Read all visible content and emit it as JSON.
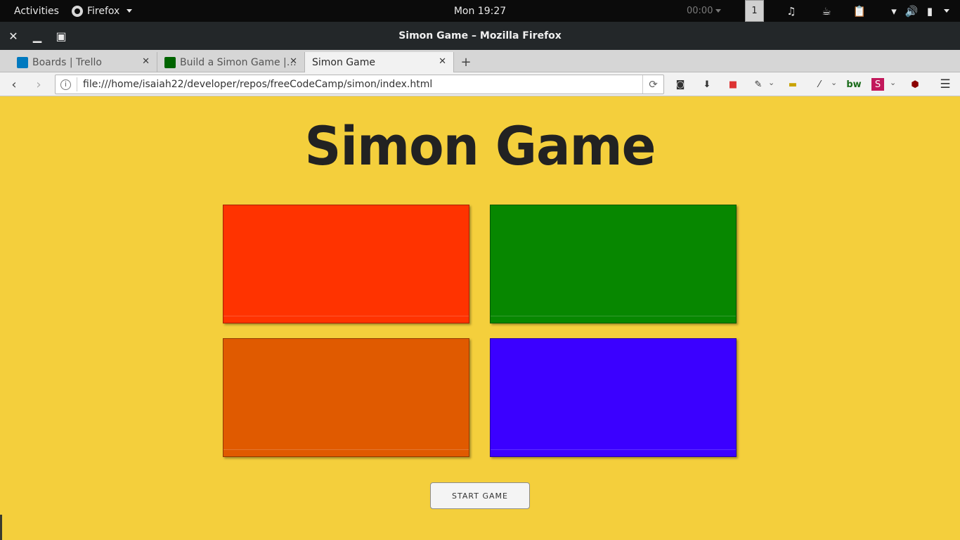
{
  "topbar": {
    "activities": "Activities",
    "app_name": "Firefox",
    "clock": "Mon 19:27",
    "timer": "00:00",
    "workspace": "1"
  },
  "window": {
    "title": "Simon Game – Mozilla Firefox"
  },
  "tabs": [
    {
      "label": "Boards | Trello",
      "favicon_color": "#0079bf",
      "active": false
    },
    {
      "label": "Build a Simon Game |…",
      "favicon_color": "#006400",
      "active": false
    },
    {
      "label": "Simon Game",
      "active": true
    }
  ],
  "navbar": {
    "url": "file:///home/isaiah22/developer/repos/freeCodeCamp/simon/index.html"
  },
  "page": {
    "title": "Simon Game",
    "pads": [
      {
        "name": "red",
        "color": "#ff3300"
      },
      {
        "name": "green",
        "color": "#078700"
      },
      {
        "name": "orange",
        "color": "#e05a00"
      },
      {
        "name": "blue",
        "color": "#3b00ff"
      }
    ],
    "start_button": "START GAME",
    "background": "#f4cf3c"
  }
}
